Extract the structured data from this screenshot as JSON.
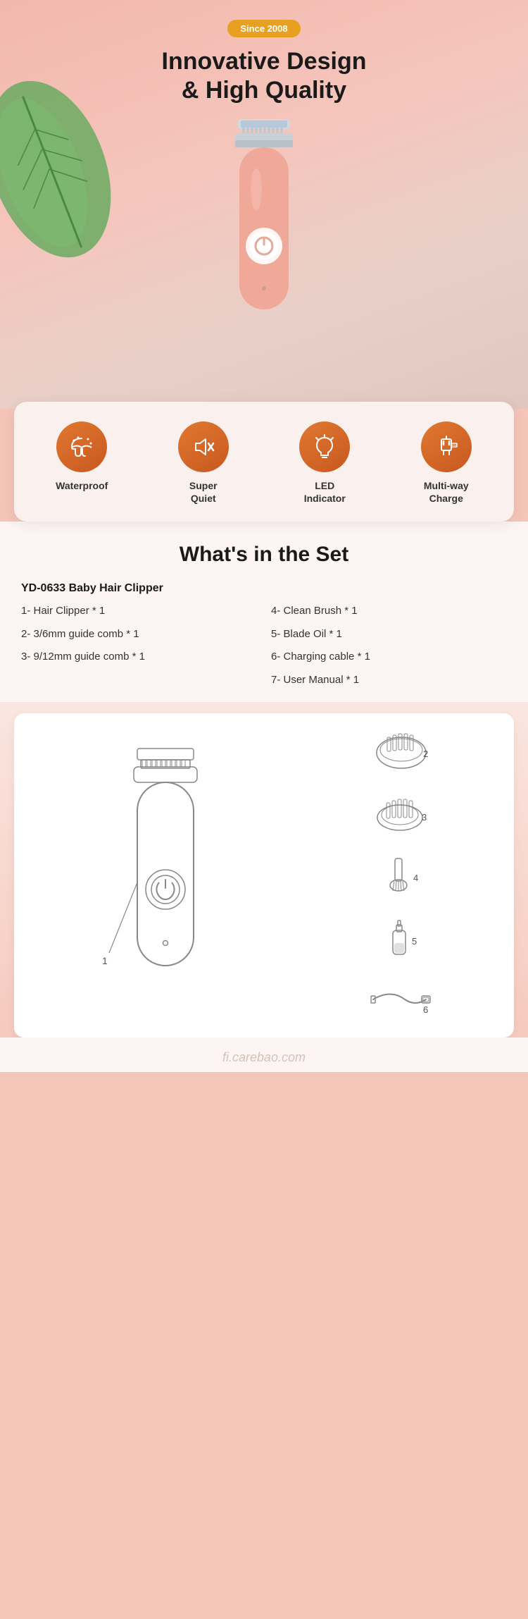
{
  "hero": {
    "badge": "Since 2008",
    "title_line1": "Innovative Design",
    "title_line2": "& High Quality"
  },
  "features": [
    {
      "id": "waterproof",
      "label": "Waterproof",
      "icon": "umbrella"
    },
    {
      "id": "super-quiet",
      "label": "Super\nQuiet",
      "icon": "volume-off"
    },
    {
      "id": "led-indicator",
      "label": "LED\nIndicator",
      "icon": "led"
    },
    {
      "id": "multi-way-charge",
      "label": "Multi-way\nCharge",
      "icon": "plug"
    }
  ],
  "set_section": {
    "title": "What's in the Set",
    "product_name": "YD-0633 Baby Hair Clipper",
    "items_col1": [
      "1- Hair Clipper * 1",
      "2- 3/6mm guide comb * 1",
      "3- 9/12mm guide comb * 1"
    ],
    "items_col2": [
      "4- Clean Brush * 1",
      "5- Blade Oil * 1",
      "6- Charging cable * 1",
      "7- User Manual * 1"
    ]
  },
  "watermark": "fi.carebao.com",
  "parts": [
    {
      "id": "part-2",
      "num": "2"
    },
    {
      "id": "part-3",
      "num": "3"
    },
    {
      "id": "part-4",
      "num": "4"
    },
    {
      "id": "part-5",
      "num": "5"
    },
    {
      "id": "part-6",
      "num": "6"
    }
  ]
}
